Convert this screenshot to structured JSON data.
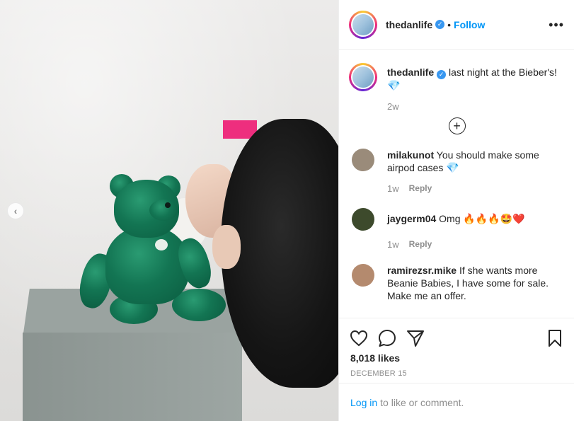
{
  "post": {
    "username": "thedanlife",
    "verified": true,
    "separator": "•",
    "follow_label": "Follow",
    "more_label": "•••"
  },
  "caption": {
    "username": "thedanlife",
    "text": "last night at the Bieber's!",
    "emoji": "💎",
    "time": "2w"
  },
  "load_more": "+",
  "comments": [
    {
      "username": "milakunot",
      "text": "You should make some airpod cases",
      "emoji": "💎",
      "time": "1w",
      "reply_label": "Reply",
      "avatar_color": "#9a8b7a"
    },
    {
      "username": "jaygerm04",
      "text": "Omg",
      "emoji": "🔥🔥🔥🤩❤️",
      "time": "1w",
      "reply_label": "Reply",
      "avatar_color": "#3d4a2c"
    },
    {
      "username": "ramirezsr.mike",
      "text": "If she wants more Beanie Babies, I have some for sale. Make me an offer.",
      "avatar_color": "#b48a6e"
    }
  ],
  "actions": {
    "likes": "8,018 likes",
    "date": "DECEMBER 15"
  },
  "login": {
    "link": "Log in",
    "text": "to like or comment."
  },
  "carousel": {
    "prev_label": "‹"
  },
  "colors": {
    "accent": "#0095f6",
    "verified": "#3897f0",
    "muted": "#8e8e8e"
  }
}
